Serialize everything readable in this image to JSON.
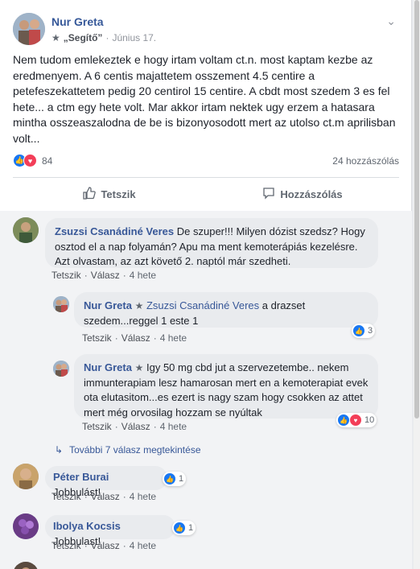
{
  "post": {
    "author": "Nur Greta",
    "badge": "„Segítő”",
    "date": "Június 17.",
    "text": "Nem tudom emlekeztek e hogy irtam voltam ct.n. most kaptam kezbe az eredmenyem. A 6 centis majattetem osszement 4.5 centire a petefeszekattetem pedig 20 centirol 15 centire. A cbdt most szedem 3 es fel hete... a ctm egy hete volt. Mar akkor irtam nektek ugy erzem a hatasara mintha osszeaszalodna de be is bizonyosodott mert az utolso ct.m aprilisban volt...",
    "reaction_count": "84",
    "comment_count": "24 hozzászólás",
    "like_label": "Tetszik",
    "comment_label": "Hozzászólás"
  },
  "comments": [
    {
      "name": "Zsuzsi Csanádiné Veres",
      "text": "De szuper!!! Milyen dózist szedsz? Hogy osztod el a nap folyamán? Apu ma ment kemoterápiás kezelésre. Azt olvastam, az azt követő 2. naptól már szedheti.",
      "like": "Tetszik",
      "reply": "Válasz",
      "time": "4 hete"
    },
    {
      "name": "Péter Burai",
      "text": "Jobbulást!",
      "react_count": "1",
      "like": "Tetszik",
      "reply": "Válasz",
      "time": "4 hete"
    },
    {
      "name": "Ibolya Kocsis",
      "text": "Jobbulast!",
      "react_count": "1",
      "like": "Tetszik",
      "reply": "Válasz",
      "time": "4 hete"
    }
  ],
  "replies": [
    {
      "name": "Nur Greta",
      "mention": "Zsuzsi Csanádiné Veres",
      "text": "a drazset szedem...reggel 1 este 1",
      "react_count": "3",
      "like": "Tetszik",
      "reply": "Válasz",
      "time": "4 hete"
    },
    {
      "name": "Nur Greta",
      "text": "Igy 50 mg cbd jut a szervezetembe.. nekem immunterapiam lesz hamarosan mert en a kemoterapiat evek ota elutasitom...es ezert is nagy szam hogy csokken az attet mert még orvosilag hozzam se nyúltak",
      "react_count": "10",
      "like": "Tetszik",
      "reply": "Válasz",
      "time": "4 hete"
    }
  ],
  "more_replies": "További 7 válasz megtekintése",
  "colors": {
    "link": "#385898",
    "like": "#1877f2",
    "love": "#f33e58"
  }
}
